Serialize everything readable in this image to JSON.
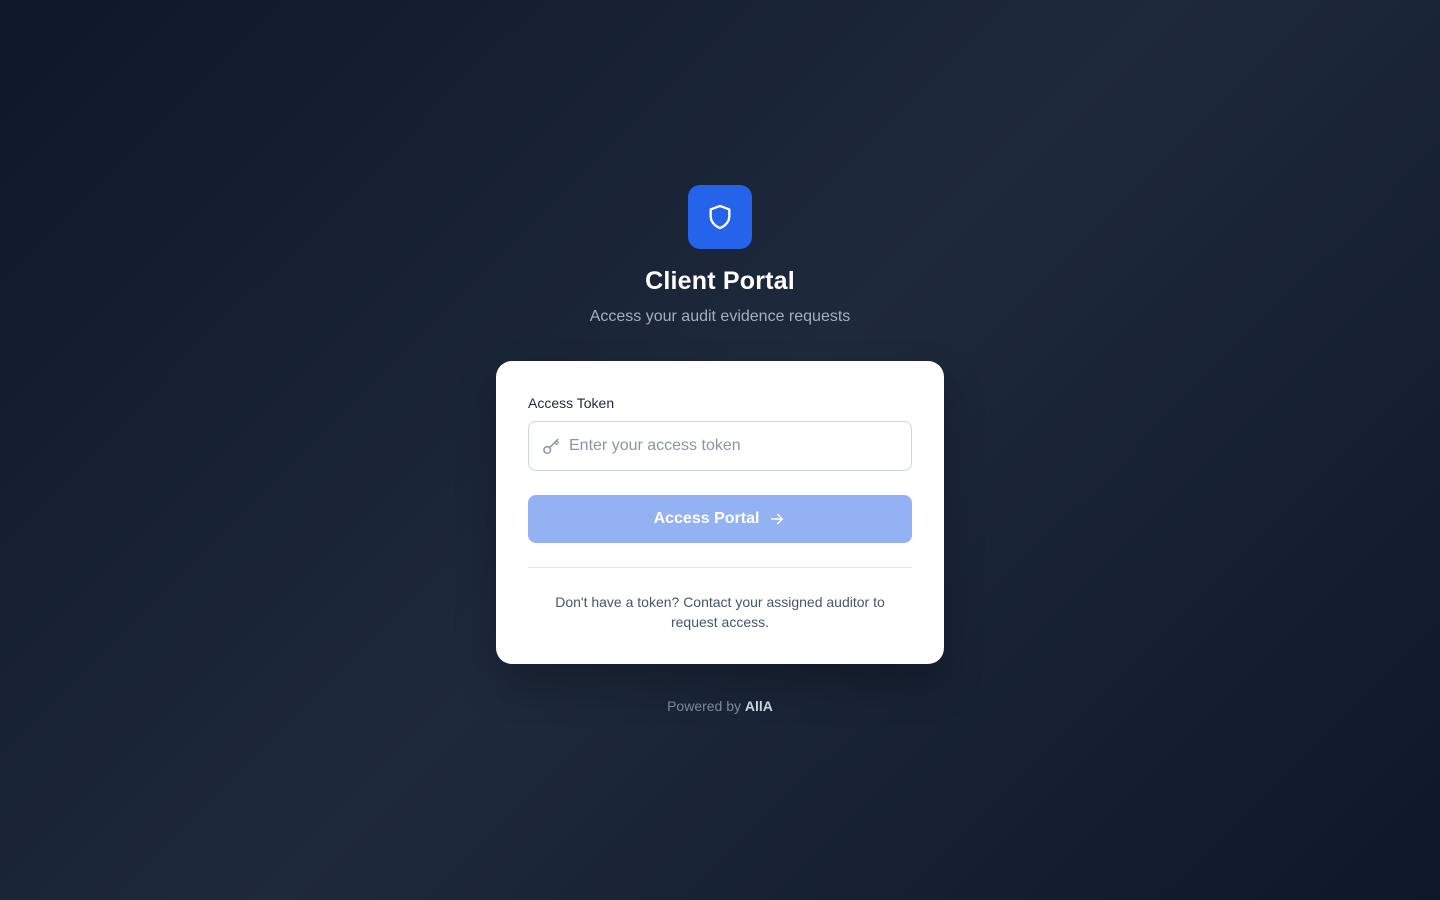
{
  "header": {
    "logo_icon": "shield-icon",
    "title": "Client Portal",
    "subtitle": "Access your audit evidence requests"
  },
  "form": {
    "token_label": "Access Token",
    "token_icon": "key-icon",
    "token_value": "",
    "token_placeholder": "Enter your access token",
    "submit_label": "Access Portal",
    "submit_icon": "arrow-right-icon",
    "help_text": "Don't have a token? Contact your assigned auditor to request access."
  },
  "footer": {
    "powered_by": "Powered by",
    "brand": "AllA"
  },
  "colors": {
    "accent": "#2563eb",
    "button_disabled": "#93b1f3",
    "background": "#0f172a"
  }
}
